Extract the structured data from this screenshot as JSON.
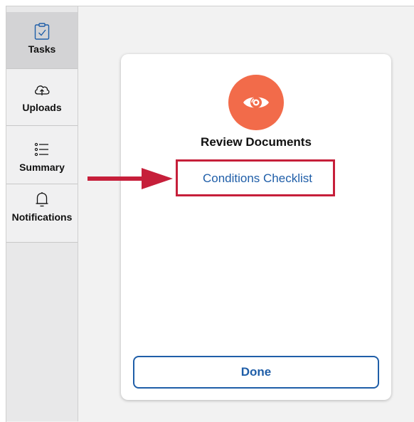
{
  "sidebar": {
    "items": [
      {
        "label": "Tasks",
        "icon": "clipboard-check-icon",
        "active": true
      },
      {
        "label": "Uploads",
        "icon": "cloud-upload-icon",
        "active": false
      },
      {
        "label": "Summary",
        "icon": "list-icon",
        "active": false
      },
      {
        "label": "Notifications",
        "icon": "bell-icon",
        "active": false
      }
    ]
  },
  "card": {
    "icon": "eye-icon",
    "icon_color": "#f26b4a",
    "title": "Review Documents",
    "link_label": "Conditions Checklist",
    "done_label": "Done"
  },
  "annotation": {
    "highlight_color": "#c61f3a",
    "target": "Conditions Checklist"
  },
  "colors": {
    "accent": "#1f5ea8",
    "sidebar_bg": "#e8e8e9",
    "sidebar_active_bg": "#d3d3d5"
  }
}
